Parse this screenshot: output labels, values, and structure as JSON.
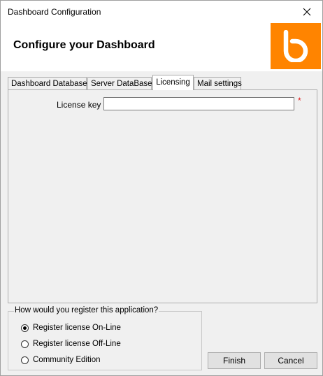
{
  "window": {
    "title": "Dashboard Configuration"
  },
  "header": {
    "heading": "Configure your Dashboard"
  },
  "tabs": [
    {
      "label": "Dashboard Database",
      "active": false
    },
    {
      "label": "Server DataBase",
      "active": false
    },
    {
      "label": "Licensing",
      "active": true
    },
    {
      "label": "Mail settings",
      "active": false
    }
  ],
  "licensing": {
    "license_key_label": "License key",
    "license_key_value": "",
    "required_marker": "*"
  },
  "registration": {
    "group_title": "How would you register this application?",
    "options": [
      {
        "label": "Register license On-Line",
        "checked": true
      },
      {
        "label": "Register license Off-Line",
        "checked": false
      },
      {
        "label": "Community Edition",
        "checked": false
      }
    ]
  },
  "buttons": {
    "finish": "Finish",
    "cancel": "Cancel"
  },
  "colors": {
    "logo_background": "#ff8400",
    "required_marker": "#e01010"
  },
  "icons": {
    "logo": "b-logo-icon",
    "close": "close-icon"
  }
}
